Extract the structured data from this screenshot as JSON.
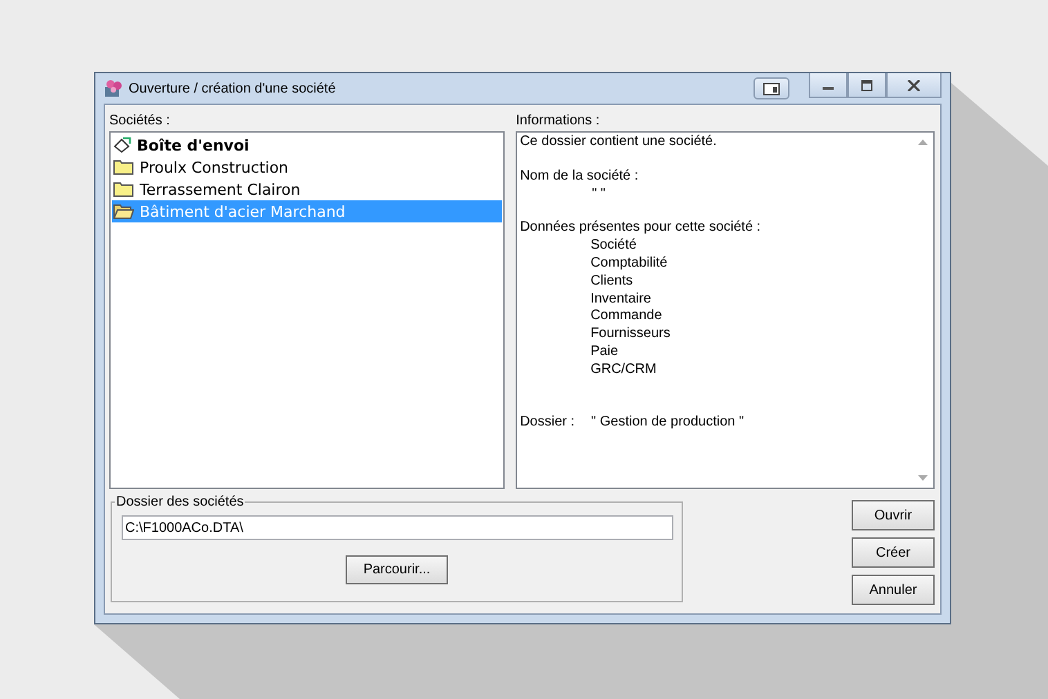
{
  "window": {
    "title": "Ouverture / création d'une société"
  },
  "companies": {
    "label": "Sociétés :",
    "items": [
      {
        "name": "Boîte d'envoi",
        "kind": "outbox",
        "selected": false
      },
      {
        "name": "Proulx Construction",
        "kind": "folder",
        "selected": false
      },
      {
        "name": "Terrassement Clairon",
        "kind": "folder",
        "selected": false
      },
      {
        "name": "Bâtiment d'acier Marchand",
        "kind": "folder",
        "selected": true
      }
    ]
  },
  "informations": {
    "label": "Informations :",
    "intro": "Ce dossier contient une société.",
    "name_label": "Nom de la société :",
    "name_value": "\" \"",
    "data_label": "Données présentes pour cette société :",
    "data_items": [
      "Société",
      "Comptabilité",
      "Clients",
      "Inventaire",
      "Commande",
      "Fournisseurs",
      "Paie",
      "GRC/CRM"
    ],
    "folder_label": "Dossier :",
    "folder_value": "\" Gestion de production \""
  },
  "folder_group": {
    "legend": "Dossier des sociétés",
    "path": "C:\\F1000ACo.DTA\\",
    "browse": "Parcourir..."
  },
  "buttons": [
    "Ouvrir",
    "Créer",
    "Annuler"
  ]
}
